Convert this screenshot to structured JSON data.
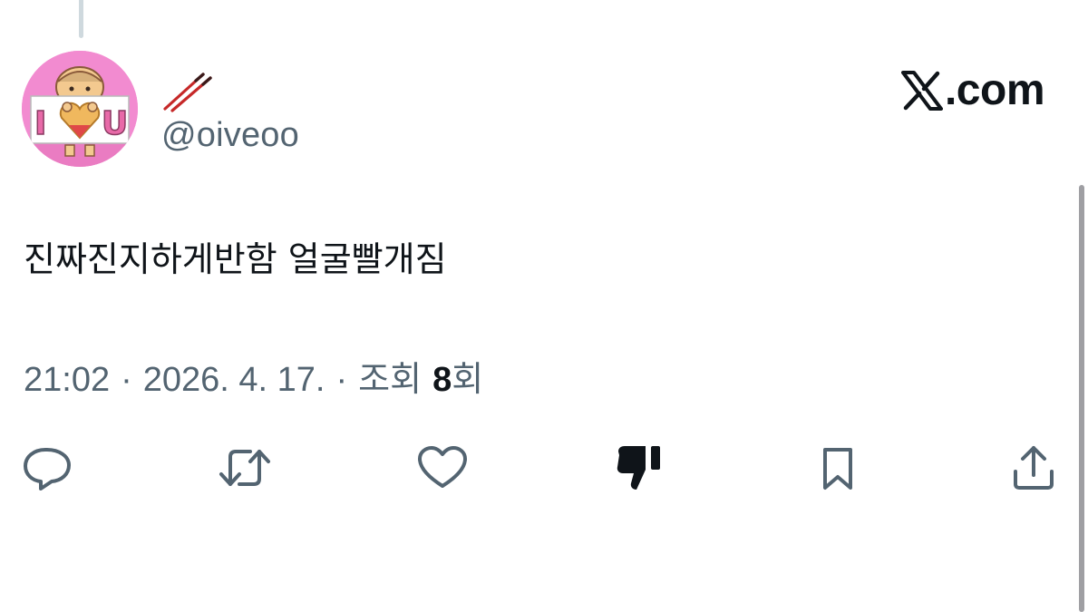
{
  "tweet": {
    "handle": "@oiveoo",
    "text": "진짜진지하게반함 얼굴빨개짐",
    "time": "21:02",
    "date": "2026. 4. 17.",
    "views_prefix": "조회",
    "views_count": "8",
    "views_suffix": "회",
    "separator": "·"
  },
  "avatar": {
    "letters": [
      "I",
      "U"
    ],
    "background_color": "#f28bd0"
  },
  "brand": {
    "logo_icon": "x-logo-icon",
    "text": ".com"
  },
  "actions": [
    {
      "name": "reply",
      "icon": "reply-icon"
    },
    {
      "name": "retweet",
      "icon": "retweet-icon"
    },
    {
      "name": "like",
      "icon": "heart-icon"
    },
    {
      "name": "dislike",
      "icon": "thumbs-down-icon"
    },
    {
      "name": "bookmark",
      "icon": "bookmark-icon"
    },
    {
      "name": "share",
      "icon": "share-icon"
    }
  ],
  "colors": {
    "text_primary": "#0f1419",
    "text_secondary": "#536471",
    "icon": "#536471",
    "avatar_pink": "#f28bd0"
  }
}
